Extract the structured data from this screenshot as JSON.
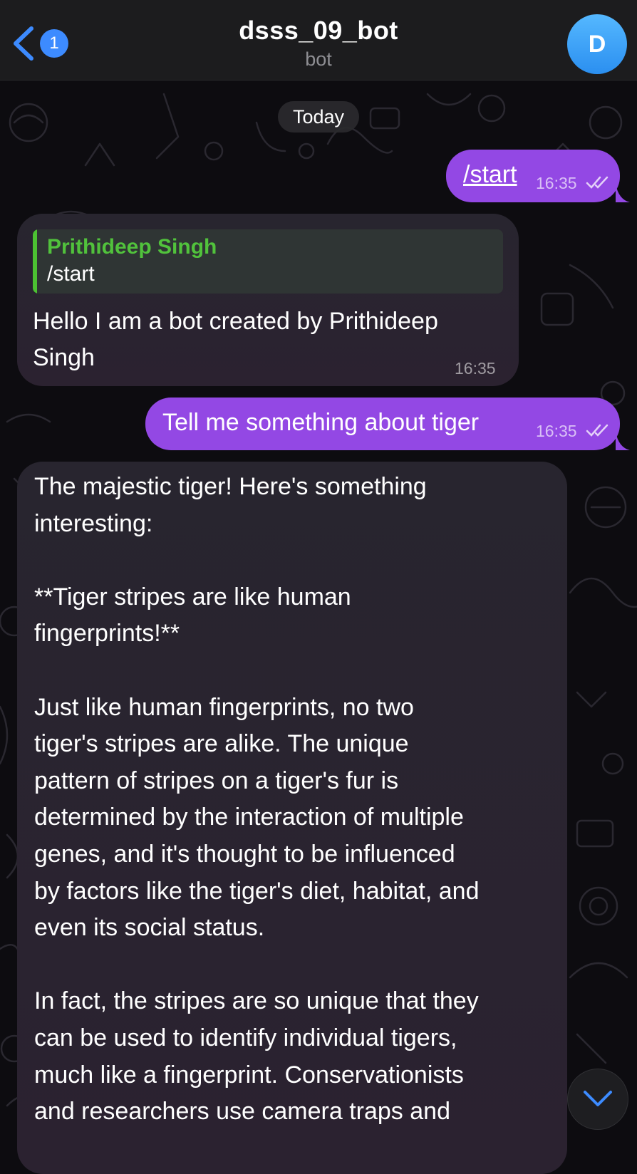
{
  "header": {
    "back_label": "Back",
    "unread_count": "1",
    "title": "dsss_09_bot",
    "subtitle": "bot",
    "avatar_initial": "D"
  },
  "date_separator": "Today",
  "messages": [
    {
      "direction": "outgoing",
      "text": "/start",
      "time": "16:35",
      "status": "read"
    },
    {
      "direction": "incoming",
      "reply_to": {
        "author": "Prithideep Singh",
        "text": "/start"
      },
      "text_lines": [
        "Hello I am a bot created by Prithideep",
        "Singh"
      ],
      "time": "16:35"
    },
    {
      "direction": "outgoing",
      "text": "Tell me something about tiger",
      "time": "16:35",
      "status": "read"
    },
    {
      "direction": "incoming",
      "text_lines": [
        "The majestic tiger! Here's something",
        "interesting:",
        "",
        "**Tiger stripes are like human",
        "fingerprints!**",
        "",
        "Just like human fingerprints, no two",
        "tiger's stripes are alike. The unique",
        "pattern of stripes on a tiger's fur is",
        "determined by the interaction of multiple",
        "genes, and it's thought to be influenced",
        "by factors like the tiger's diet, habitat, and",
        "even its social status.",
        "",
        "In fact, the stripes are so unique that they",
        "can be used to identify individual tigers,",
        "much like a fingerprint. Conservationists",
        "and researchers use camera traps and"
      ]
    }
  ],
  "colors": {
    "outgoing_bubble": "#9348e4",
    "incoming_bubble": "#28252f",
    "reply_accent": "#4cc232",
    "header_bg": "#1c1c1e",
    "accent_blue": "#3d8bff"
  },
  "icons": {
    "back": "chevron-left-icon",
    "read_status": "double-check-icon",
    "scroll_down": "chevron-down-icon"
  }
}
